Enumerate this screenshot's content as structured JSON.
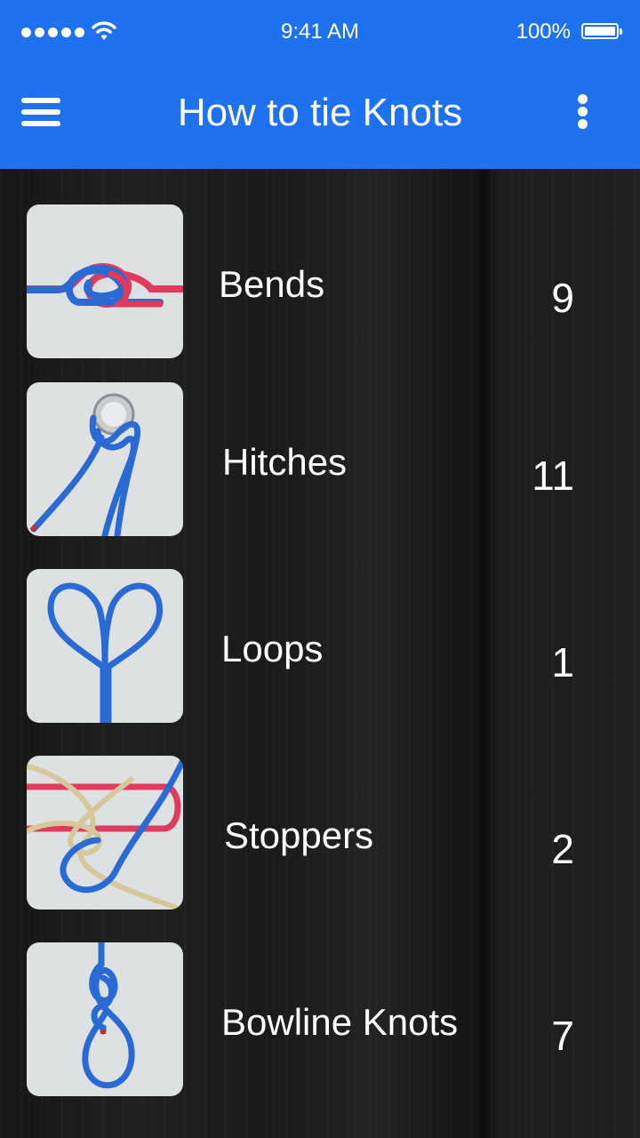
{
  "status_bar": {
    "time": "9:41 AM",
    "battery": "100%"
  },
  "header": {
    "title": "How to tie Knots",
    "menu_icon": "hamburger-menu-icon",
    "more_icon": "more-vertical-icon",
    "color": "#1f72ee"
  },
  "categories": [
    {
      "label": "Bends",
      "count": "9"
    },
    {
      "label": "Hitches",
      "count": "11"
    },
    {
      "label": "Loops",
      "count": "1"
    },
    {
      "label": "Stoppers",
      "count": "2"
    },
    {
      "label": "Bowline Knots",
      "count": "7"
    }
  ]
}
